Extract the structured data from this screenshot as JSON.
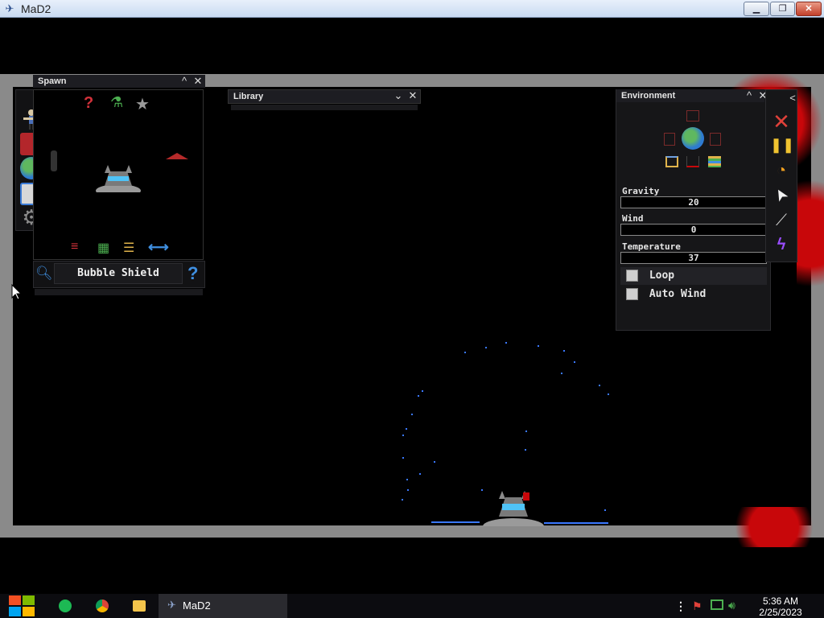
{
  "window": {
    "title": "MaD2",
    "minimize": "▁",
    "maximize": "❐",
    "close": "✕"
  },
  "spawn_panel": {
    "title": "Spawn",
    "collapse": "^",
    "close": "✕",
    "expand": ">",
    "selected_item": "Bubble Shield",
    "help": "?",
    "tabs_top": [
      {
        "icon": "question-icon",
        "glyph": "?"
      },
      {
        "icon": "flask-icon",
        "glyph": "⚗"
      },
      {
        "icon": "star-icon",
        "glyph": "★"
      }
    ],
    "tabs_bottom": [
      {
        "icon": "sliders-icon",
        "glyph": "≡"
      },
      {
        "icon": "grid-icon",
        "glyph": "▦"
      },
      {
        "icon": "list-icon",
        "glyph": "☰"
      },
      {
        "icon": "swap-icon",
        "glyph": "⟷"
      }
    ],
    "sidebar": [
      {
        "icon": "character-icon"
      },
      {
        "icon": "book-icon"
      },
      {
        "icon": "globe-icon"
      },
      {
        "icon": "save-icon"
      },
      {
        "icon": "settings-gear-icon"
      }
    ]
  },
  "library_panel": {
    "title": "Library",
    "dropdown": "⌄",
    "close": "✕"
  },
  "environment_panel": {
    "title": "Environment",
    "collapse": "^",
    "close": "✕",
    "toolbar_collapse": "<",
    "gravity": {
      "label": "Gravity",
      "value": "20"
    },
    "wind": {
      "label": "Wind",
      "value": "0"
    },
    "temperature": {
      "label": "Temperature",
      "value": "37"
    },
    "loop": {
      "label": "Loop",
      "checked": false
    },
    "auto_wind": {
      "label": "Auto Wind",
      "checked": false
    }
  },
  "toolbar": [
    {
      "icon": "delete-x-icon",
      "glyph": "✕",
      "color": "#e0413a"
    },
    {
      "icon": "pause-icon",
      "glyph": "❚❚",
      "color": "#f0c330"
    },
    {
      "icon": "stopwatch-icon",
      "glyph": "◔",
      "color": "#f0a020"
    },
    {
      "icon": "cursor-icon",
      "glyph": "➤",
      "color": "#f2f2f2"
    },
    {
      "icon": "knife-icon",
      "glyph": "⟋",
      "color": "#cccccc"
    },
    {
      "icon": "lightning-icon",
      "glyph": "ϟ",
      "color": "#9a4dff"
    }
  ],
  "taskbar": {
    "active_app": "MaD2",
    "time": "5:36 AM",
    "date": "2/25/2023"
  },
  "colors": {
    "blood": "#c8070a",
    "arena_frame": "#8a8a8a",
    "panel_bg": "#161618"
  }
}
